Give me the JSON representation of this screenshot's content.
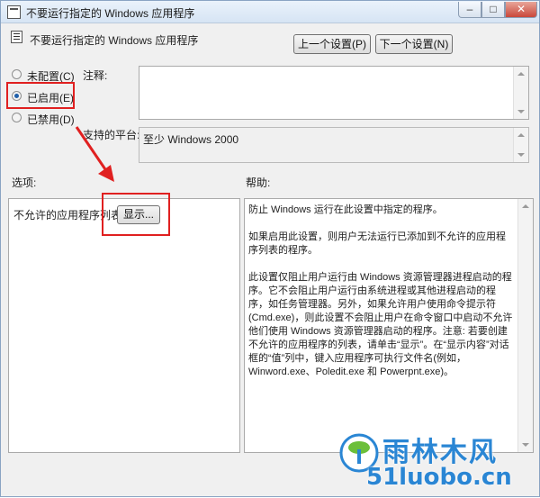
{
  "window": {
    "title": "不要运行指定的 Windows 应用程序",
    "minimize": "–",
    "maximize": "□",
    "close": "✕"
  },
  "header": {
    "title": "不要运行指定的 Windows 应用程序",
    "prev_button": "上一个设置(P)",
    "next_button": "下一个设置(N)"
  },
  "options": [
    {
      "label": "未配置(C)",
      "selected": false
    },
    {
      "label": "已启用(E)",
      "selected": true
    },
    {
      "label": "已禁用(D)",
      "selected": false
    }
  ],
  "comment": {
    "label": "注释:",
    "value": ""
  },
  "platform": {
    "label": "支持的平台:",
    "value": "至少 Windows 2000"
  },
  "options_pane": {
    "label": "选项:",
    "item_label": "不允许的应用程序列表",
    "show_button": "显示..."
  },
  "help_pane": {
    "label": "帮助:",
    "paragraphs": [
      "防止 Windows 运行在此设置中指定的程序。",
      "如果启用此设置，则用户无法运行已添加到不允许的应用程序列表的程序。",
      "此设置仅阻止用户运行由 Windows 资源管理器进程启动的程序。它不会阻止用户运行由系统进程或其他进程启动的程序，如任务管理器。另外，如果允许用户使用命令提示符(Cmd.exe)，则此设置不会阻止用户在命令窗口中启动不允许他们使用 Windows 资源管理器启动的程序。注意: 若要创建不允许的应用程序的列表，请单击“显示”。在“显示内容”对话框的“值”列中，键入应用程序可执行文件名(例如，Winword.exe、Poledit.exe 和 Powerpnt.exe)。"
    ]
  },
  "watermark": {
    "brand": "雨林木风",
    "domain": "51luobo.cn"
  },
  "colors": {
    "annotation_red": "#e02020",
    "watermark_blue": "#2a86d4"
  }
}
